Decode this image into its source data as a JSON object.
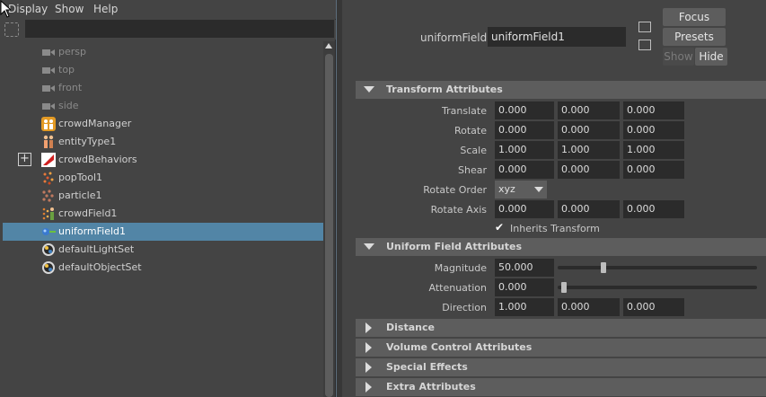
{
  "menubar": {
    "items": [
      "Display",
      "Show",
      "Help"
    ]
  },
  "outliner": {
    "search_value": "",
    "items": [
      {
        "label": "persp",
        "icon": "camera-icon",
        "dim": true
      },
      {
        "label": "top",
        "icon": "camera-icon",
        "dim": true
      },
      {
        "label": "front",
        "icon": "camera-icon",
        "dim": true
      },
      {
        "label": "side",
        "icon": "camera-icon",
        "dim": true
      },
      {
        "label": "crowdManager",
        "icon": "crowd-manager-icon",
        "dim": false
      },
      {
        "label": "entityType1",
        "icon": "entity-type-icon",
        "dim": false
      },
      {
        "label": "crowdBehaviors",
        "icon": "crowd-behaviors-icon",
        "dim": false,
        "expandable": true
      },
      {
        "label": "popTool1",
        "icon": "pop-tool-icon",
        "dim": false
      },
      {
        "label": "particle1",
        "icon": "particle-icon",
        "dim": false
      },
      {
        "label": "crowdField1",
        "icon": "crowd-field-icon",
        "dim": false
      },
      {
        "label": "uniformField1",
        "icon": "uniform-field-icon",
        "dim": false,
        "selected": true
      },
      {
        "label": "defaultLightSet",
        "icon": "set-icon",
        "dim": false
      },
      {
        "label": "defaultObjectSet",
        "icon": "set-icon",
        "dim": false
      }
    ]
  },
  "attribute_editor": {
    "node_label": "uniformField:",
    "node_value": "uniformField1",
    "focus_label": "Focus",
    "presets_label": "Presets",
    "show_label": "Show",
    "hide_label": "Hide",
    "transform": {
      "title": "Transform Attributes",
      "translate": {
        "label": "Translate",
        "values": [
          "0.000",
          "0.000",
          "0.000"
        ]
      },
      "rotate": {
        "label": "Rotate",
        "values": [
          "0.000",
          "0.000",
          "0.000"
        ]
      },
      "scale": {
        "label": "Scale",
        "values": [
          "1.000",
          "1.000",
          "1.000"
        ]
      },
      "shear": {
        "label": "Shear",
        "values": [
          "0.000",
          "0.000",
          "0.000"
        ]
      },
      "rotate_order": {
        "label": "Rotate Order",
        "value": "xyz"
      },
      "rotate_axis": {
        "label": "Rotate Axis",
        "values": [
          "0.000",
          "0.000",
          "0.000"
        ]
      },
      "inherits": {
        "label": "Inherits Transform",
        "checked": true
      }
    },
    "uniform": {
      "title": "Uniform Field Attributes",
      "magnitude": {
        "label": "Magnitude",
        "value": "50.000",
        "slider": 0.22
      },
      "attenuation": {
        "label": "Attenuation",
        "value": "0.000",
        "slider": 0.0
      },
      "direction": {
        "label": "Direction",
        "values": [
          "1.000",
          "0.000",
          "0.000"
        ]
      }
    },
    "collapsed_sections": [
      "Distance",
      "Volume Control Attributes",
      "Special Effects",
      "Extra Attributes"
    ]
  },
  "colors": {
    "panel_bg": "#444444",
    "field_bg": "#2b2b2b",
    "section_bg": "#5d5d5d",
    "selection": "#5285a6"
  }
}
